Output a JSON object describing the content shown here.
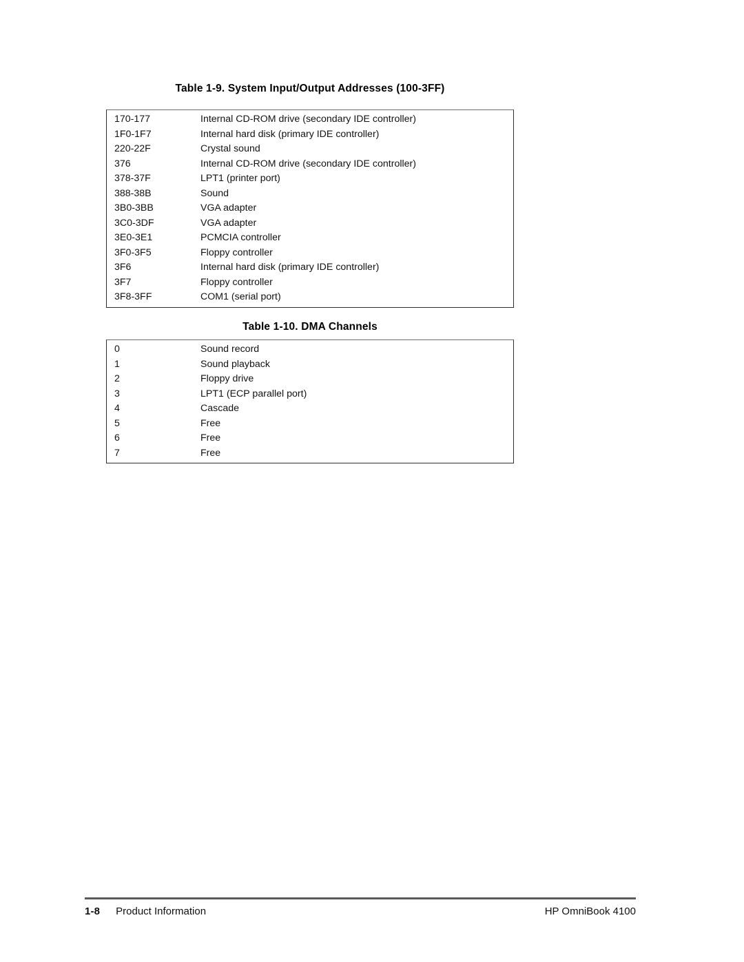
{
  "page": {
    "footer": {
      "page_number": "1-8",
      "section": "Product Information",
      "product": "HP OmniBook 4100"
    }
  },
  "tables": [
    {
      "caption": "Table 1-9. System Input/Output Addresses (100-3FF)",
      "rows": [
        {
          "key": "170-177",
          "desc": "Internal CD-ROM drive (secondary IDE controller)"
        },
        {
          "key": "1F0-1F7",
          "desc": "Internal hard disk (primary IDE controller)"
        },
        {
          "key": "220-22F",
          "desc": "Crystal sound"
        },
        {
          "key": "376",
          "desc": "Internal CD-ROM drive (secondary IDE controller)"
        },
        {
          "key": "378-37F",
          "desc": "LPT1 (printer port)"
        },
        {
          "key": "388-38B",
          "desc": "Sound"
        },
        {
          "key": "3B0-3BB",
          "desc": "VGA adapter"
        },
        {
          "key": "3C0-3DF",
          "desc": "VGA adapter"
        },
        {
          "key": "3E0-3E1",
          "desc": "PCMCIA controller"
        },
        {
          "key": "3F0-3F5",
          "desc": "Floppy controller"
        },
        {
          "key": "3F6",
          "desc": "Internal hard disk (primary IDE controller)"
        },
        {
          "key": "3F7",
          "desc": "Floppy controller"
        },
        {
          "key": "3F8-3FF",
          "desc": "COM1 (serial port)"
        }
      ]
    },
    {
      "caption": "Table 1-10. DMA Channels",
      "rows": [
        {
          "key": "0",
          "desc": "Sound record"
        },
        {
          "key": "1",
          "desc": "Sound playback"
        },
        {
          "key": "2",
          "desc": "Floppy drive"
        },
        {
          "key": "3",
          "desc": "LPT1 (ECP parallel port)"
        },
        {
          "key": "4",
          "desc": "Cascade"
        },
        {
          "key": "5",
          "desc": "Free"
        },
        {
          "key": "6",
          "desc": "Free"
        },
        {
          "key": "7",
          "desc": "Free"
        }
      ]
    }
  ]
}
